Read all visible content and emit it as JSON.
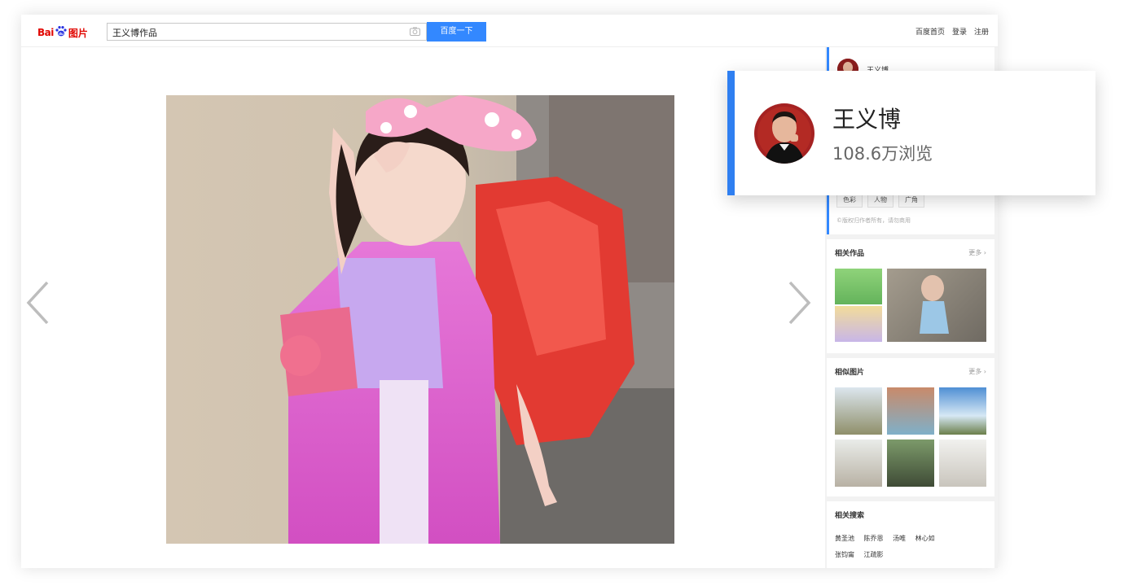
{
  "header": {
    "logo_bai": "Bai",
    "logo_paw": "du",
    "logo_pic": "图片",
    "search_value": "王义博作品",
    "search_button": "百度一下",
    "links": [
      "百度首页",
      "登录",
      "注册"
    ]
  },
  "sidebar": {
    "author_name": "王义博",
    "tags": [
      "色彩",
      "人物",
      "广角"
    ],
    "copyright": "©版权归作者所有，请勿商用",
    "works_title": "相关作品",
    "similar_title": "相似图片",
    "related_title": "相关搜索",
    "more_label": "更多",
    "related_row1": [
      "黄圣池",
      "陈乔恩",
      "汤唯",
      "林心如"
    ],
    "related_row2": [
      "张钧甯",
      "江疏影"
    ]
  },
  "popup": {
    "name": "王义博",
    "views": "108.6万浏览"
  },
  "icons": {
    "prev": "chevron-left-icon",
    "next": "chevron-right-icon",
    "camera": "camera-icon",
    "more": "circle-arrow-icon"
  },
  "colors": {
    "accent": "#3388ff",
    "popup_bar": "#2f7ff1",
    "logo_red": "#e10601",
    "logo_blue": "#2932e1"
  }
}
